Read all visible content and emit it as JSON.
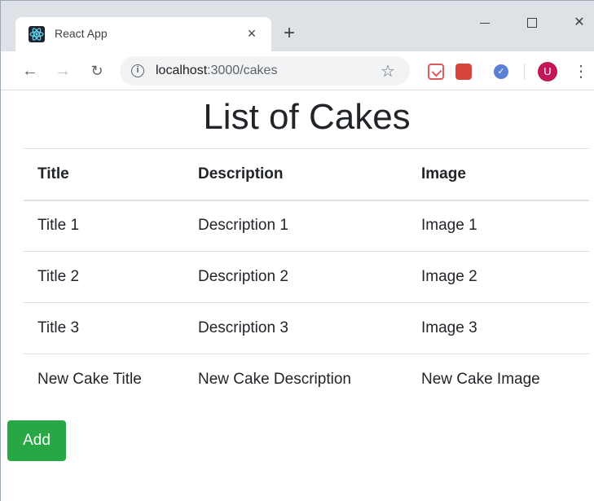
{
  "browser": {
    "tab_title": "React App",
    "tab_close": "×",
    "new_tab": "+",
    "url_host": "localhost",
    "url_path": ":3000/cakes",
    "avatar_letter": "U"
  },
  "page": {
    "title": "List of Cakes",
    "table": {
      "headers": [
        "Title",
        "Description",
        "Image"
      ],
      "rows": [
        [
          "Title 1",
          "Description 1",
          "Image 1"
        ],
        [
          "Title 2",
          "Description 2",
          "Image 2"
        ],
        [
          "Title 3",
          "Description 3",
          "Image 3"
        ],
        [
          "New Cake Title",
          "New Cake Description",
          "New Cake Image"
        ]
      ]
    },
    "add_label": "Add"
  },
  "colors": {
    "add_button": "#28a745",
    "avatar": "#c2185b"
  }
}
